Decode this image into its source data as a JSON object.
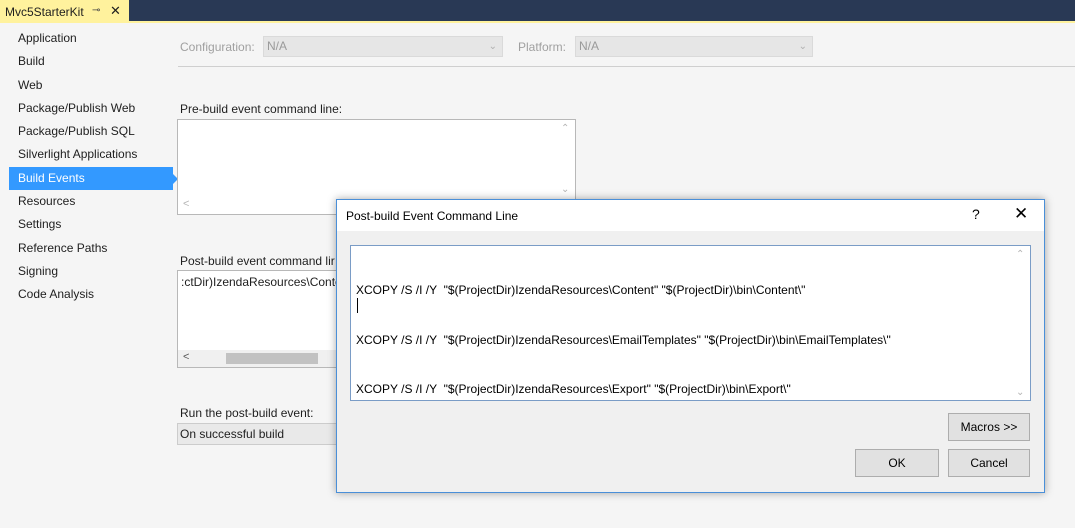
{
  "tab": {
    "title": "Mvc5StarterKit",
    "pin_glyph": "⊸",
    "close_glyph": "✕"
  },
  "nav": {
    "items": [
      {
        "label": "Application"
      },
      {
        "label": "Build"
      },
      {
        "label": "Web"
      },
      {
        "label": "Package/Publish Web"
      },
      {
        "label": "Package/Publish SQL"
      },
      {
        "label": "Silverlight Applications"
      },
      {
        "label": "Build Events",
        "active": true
      },
      {
        "label": "Resources"
      },
      {
        "label": "Settings"
      },
      {
        "label": "Reference Paths"
      },
      {
        "label": "Signing"
      },
      {
        "label": "Code Analysis"
      }
    ]
  },
  "config": {
    "configuration_label": "Configuration:",
    "configuration_value": "N/A",
    "platform_label": "Platform:",
    "platform_value": "N/A"
  },
  "prebuild": {
    "label": "Pre-build event command line:",
    "value": ""
  },
  "postbuild": {
    "label": "Post-build event command lir",
    "visible_text": ":ctDir)IzendaResources\\Conte"
  },
  "run_post": {
    "label": "Run the post-build event:",
    "value": "On successful build"
  },
  "dialog": {
    "title": "Post-build Event Command Line",
    "help_glyph": "?",
    "close_glyph": "✕",
    "lines": [
      "XCOPY /S /I /Y  \"$(ProjectDir)IzendaResources\\Content\" \"$(ProjectDir)\\bin\\Content\\\"",
      "XCOPY /S /I /Y  \"$(ProjectDir)IzendaResources\\EmailTemplates\" \"$(ProjectDir)\\bin\\EmailTemplates\\\"",
      "XCOPY /S /I /Y  \"$(ProjectDir)IzendaResources\\Export\" \"$(ProjectDir)\\bin\\Export\\\""
    ],
    "macros_label": "Macros >>",
    "ok_label": "OK",
    "cancel_label": "Cancel"
  },
  "colors": {
    "titlebar": "#293955",
    "tab_active": "#fff29d",
    "nav_selected": "#3399ff",
    "dialog_border": "#4a8fd8"
  }
}
